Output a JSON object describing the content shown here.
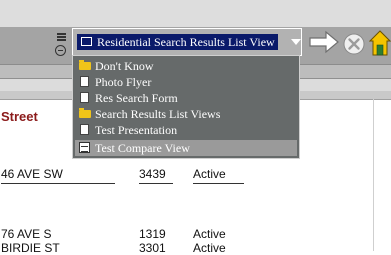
{
  "toolbar": {
    "selected_view": "Residential Search Results List View"
  },
  "menu": {
    "items": [
      {
        "label": "Don't Know",
        "icon": "folder-icon"
      },
      {
        "label": "Photo Flyer",
        "icon": "document-icon"
      },
      {
        "label": "Res Search Form",
        "icon": "document-icon"
      },
      {
        "label": "Search Results List Views",
        "icon": "folder-icon"
      },
      {
        "label": "Test Presentation",
        "icon": "document-icon"
      },
      {
        "label": "Test Compare View",
        "icon": "grid-icon",
        "highlighted": true
      }
    ]
  },
  "results": {
    "column_header": "Street",
    "rows": [
      {
        "street": "46 AVE SW",
        "number": "3439",
        "status": "Active"
      },
      {
        "street": "76 AVE S",
        "number": "1319",
        "status": "Active"
      },
      {
        "street": "BIRDIE ST",
        "number": "3301",
        "status": "Active"
      }
    ]
  },
  "colors": {
    "combo_highlight": "#0a1a6a",
    "menu_bg": "#666a6a",
    "header_text": "#8b1a1a",
    "home_icon": "#f5c400"
  }
}
